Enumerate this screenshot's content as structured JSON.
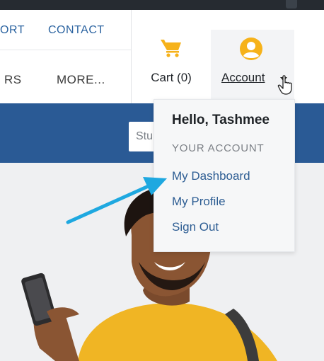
{
  "nav": {
    "row1": {
      "support_partial": "ORT",
      "contact": "CONTACT"
    },
    "row2": {
      "item_partial": "RS",
      "more": "MORE..."
    }
  },
  "cart": {
    "label": "Cart (0)",
    "icon": "cart-icon"
  },
  "account": {
    "label": "Account",
    "icon": "account-circle-icon",
    "caret_icon": "caret-down-icon"
  },
  "search": {
    "partial_text": "Stu"
  },
  "dropdown": {
    "greeting": "Hello, Tashmee",
    "section_title": "YOUR ACCOUNT",
    "items": [
      {
        "label": "My Dashboard"
      },
      {
        "label": "My Profile"
      },
      {
        "label": "Sign Out"
      }
    ]
  },
  "colors": {
    "topbar": "#262b31",
    "band": "#2a5a95",
    "link_blue": "#2b63a0",
    "accent_yellow": "#f6b21a",
    "arrow_blue": "#1ea8e0"
  }
}
